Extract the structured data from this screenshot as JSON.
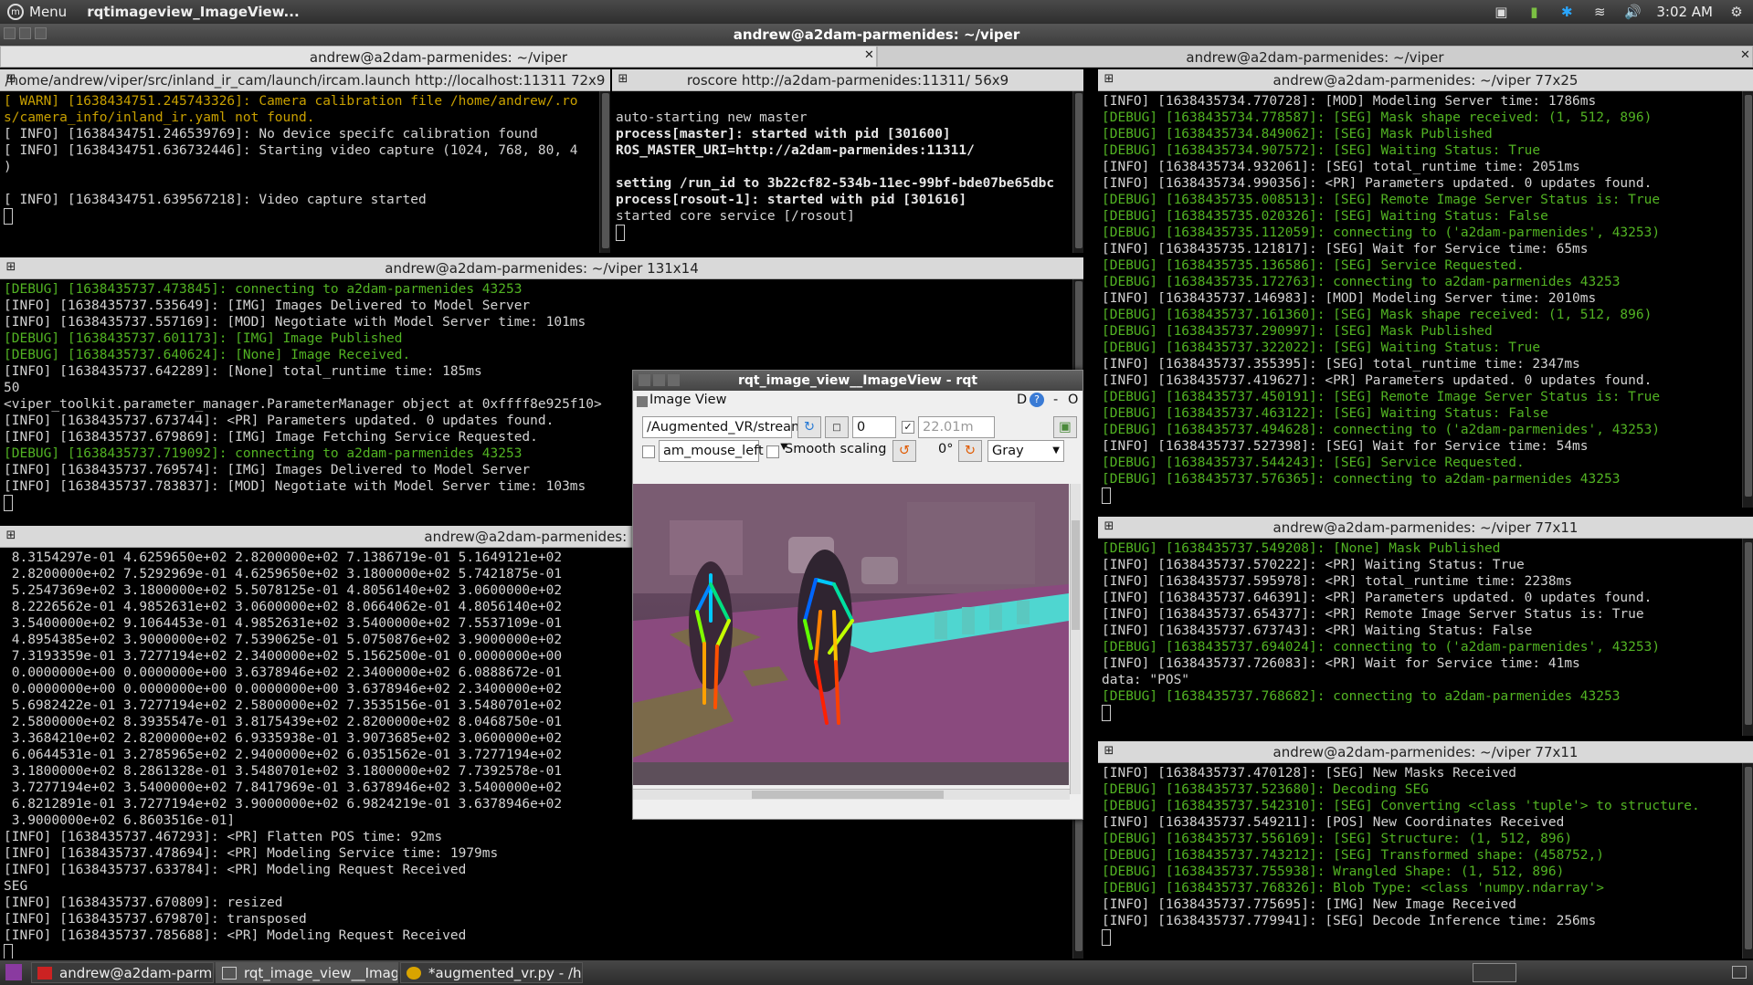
{
  "topbar": {
    "menu_label": "Menu",
    "app_title": "rqtimageview_ImageView...",
    "clock": "3:02 AM"
  },
  "window_title": "andrew@a2dam-parmenides: ~/viper",
  "tabs": [
    {
      "label": "andrew@a2dam-parmenides: ~/viper"
    },
    {
      "label": "andrew@a2dam-parmenides: ~/viper"
    }
  ],
  "panes": {
    "launch": {
      "title": "/home/andrew/viper/src/inland_ir_cam/launch/ircam.launch http://localhost:11311 72x9",
      "lines": [
        {
          "t": "[ WARN] [1638434751.245743326]: Camera calibration file /home/andrew/.ro",
          "c": "y"
        },
        {
          "t": "s/camera_info/inland_ir.yaml not found.",
          "c": "y"
        },
        {
          "t": "[ INFO] [1638434751.246539769]: No device specifc calibration found",
          "c": "w"
        },
        {
          "t": "[ INFO] [1638434751.636732446]: Starting video capture (1024, 768, 80, 4",
          "c": "w"
        },
        {
          "t": ")",
          "c": "w"
        },
        {
          "t": "",
          "c": "w"
        },
        {
          "t": "[ INFO] [1638434751.639567218]: Video capture started",
          "c": "w"
        }
      ]
    },
    "roscore": {
      "title": "roscore http://a2dam-parmenides:11311/ 56x9",
      "lines": [
        {
          "t": "",
          "c": "w"
        },
        {
          "t": "auto-starting new master",
          "c": "w"
        },
        {
          "t": "process[master]: started with pid [301600]",
          "c": "b"
        },
        {
          "t": "ROS_MASTER_URI=http://a2dam-parmenides:11311/",
          "c": "b"
        },
        {
          "t": "",
          "c": "w"
        },
        {
          "t": "setting /run_id to 3b22cf82-534b-11ec-99bf-bde07be65dbc",
          "c": "b"
        },
        {
          "t": "process[rosout-1]: started with pid [301616]",
          "c": "b"
        },
        {
          "t": "started core service [/rosout]",
          "c": "w"
        }
      ]
    },
    "mid": {
      "title": "andrew@a2dam-parmenides: ~/viper 131x14",
      "lines": [
        {
          "t": "[DEBUG] [1638435737.473845]: connecting to a2dam-parmenides 43253",
          "c": "g"
        },
        {
          "t": "[INFO] [1638435737.535649]: [IMG] Images Delivered to Model Server",
          "c": "w"
        },
        {
          "t": "[INFO] [1638435737.557169]: [MOD] Negotiate with Model Server time: 101ms",
          "c": "w"
        },
        {
          "t": "[DEBUG] [1638435737.601173]: [IMG] Image Published",
          "c": "g"
        },
        {
          "t": "[DEBUG] [1638435737.640624]: [None] Image Received.",
          "c": "g"
        },
        {
          "t": "[INFO] [1638435737.642289]: [None] total_runtime time: 185ms",
          "c": "w"
        },
        {
          "t": "50",
          "c": "w"
        },
        {
          "t": "<viper_toolkit.parameter_manager.ParameterManager object at 0xffff8e925f10>",
          "c": "w"
        },
        {
          "t": "[INFO] [1638435737.673744]: <PR] Parameters updated. 0 updates found.",
          "c": "w"
        },
        {
          "t": "[INFO] [1638435737.679869]: [IMG] Image Fetching Service Requested.",
          "c": "w"
        },
        {
          "t": "[DEBUG] [1638435737.719092]: connecting to a2dam-parmenides 43253",
          "c": "g"
        },
        {
          "t": "[INFO] [1638435737.769574]: [IMG] Images Delivered to Model Server",
          "c": "w"
        },
        {
          "t": "[INFO] [1638435737.783837]: [MOD] Negotiate with Model Server time: 103ms",
          "c": "w"
        }
      ]
    },
    "bottom": {
      "title": "andrew@a2dam-parmenides: ~/vi",
      "lines": [
        {
          "t": " 8.3154297e-01 4.6259650e+02 2.8200000e+02 7.1386719e-01 5.1649121e+02",
          "c": "w"
        },
        {
          "t": " 2.8200000e+02 7.5292969e-01 4.6259650e+02 3.1800000e+02 5.7421875e-01",
          "c": "w"
        },
        {
          "t": " 5.2547369e+02 3.1800000e+02 5.5078125e-01 4.8056140e+02 3.0600000e+02",
          "c": "w"
        },
        {
          "t": " 8.2226562e-01 4.9852631e+02 3.0600000e+02 8.0664062e-01 4.8056140e+02",
          "c": "w"
        },
        {
          "t": " 3.5400000e+02 9.1064453e-01 4.9852631e+02 3.5400000e+02 7.5537109e-01",
          "c": "w"
        },
        {
          "t": " 4.8954385e+02 3.9000000e+02 7.5390625e-01 5.0750876e+02 3.9000000e+02",
          "c": "w"
        },
        {
          "t": " 7.3193359e-01 3.7277194e+02 2.3400000e+02 5.1562500e-01 0.0000000e+00",
          "c": "w"
        },
        {
          "t": " 0.0000000e+00 0.0000000e+00 3.6378946e+02 2.3400000e+02 6.0888672e-01",
          "c": "w"
        },
        {
          "t": " 0.0000000e+00 0.0000000e+00 0.0000000e+00 3.6378946e+02 2.3400000e+02",
          "c": "w"
        },
        {
          "t": " 5.6982422e-01 3.7277194e+02 2.5800000e+02 7.3535156e-01 3.5480701e+02",
          "c": "w"
        },
        {
          "t": " 2.5800000e+02 8.3935547e-01 3.8175439e+02 2.8200000e+02 8.0468750e-01",
          "c": "w"
        },
        {
          "t": " 3.3684210e+02 2.8200000e+02 6.9335938e-01 3.9073685e+02 3.0600000e+02",
          "c": "w"
        },
        {
          "t": " 6.0644531e-01 3.2785965e+02 2.9400000e+02 6.0351562e-01 3.7277194e+02",
          "c": "w"
        },
        {
          "t": " 3.1800000e+02 8.2861328e-01 3.5480701e+02 3.1800000e+02 7.7392578e-01",
          "c": "w"
        },
        {
          "t": " 3.7277194e+02 3.5400000e+02 7.8417969e-01 3.6378946e+02 3.5400000e+02",
          "c": "w"
        },
        {
          "t": " 6.8212891e-01 3.7277194e+02 3.9000000e+02 6.9824219e-01 3.6378946e+02",
          "c": "w"
        },
        {
          "t": " 3.9000000e+02 6.8603516e-01]",
          "c": "w"
        },
        {
          "t": "[INFO] [1638435737.467293]: <PR] Flatten POS time: 92ms",
          "c": "w"
        },
        {
          "t": "[INFO] [1638435737.478694]: <PR] Modeling Service time: 1979ms",
          "c": "w"
        },
        {
          "t": "[INFO] [1638435737.633784]: <PR] Modeling Request Received",
          "c": "w"
        },
        {
          "t": "SEG",
          "c": "w"
        },
        {
          "t": "[INFO] [1638435737.670809]: resized",
          "c": "w"
        },
        {
          "t": "[INFO] [1638435737.679870]: transposed",
          "c": "w"
        },
        {
          "t": "[INFO] [1638435737.785688]: <PR] Modeling Request Received",
          "c": "w"
        }
      ]
    },
    "r1": {
      "title": "andrew@a2dam-parmenides: ~/viper 77x25",
      "lines": [
        {
          "t": "[INFO] [1638435734.770728]: [MOD] Modeling Server time: 1786ms",
          "c": "w"
        },
        {
          "t": "[DEBUG] [1638435734.778587]: [SEG] Mask shape received: (1, 512, 896)",
          "c": "g"
        },
        {
          "t": "[DEBUG] [1638435734.849062]: [SEG] Mask Published",
          "c": "g"
        },
        {
          "t": "[DEBUG] [1638435734.907572]: [SEG] Waiting Status: True",
          "c": "g"
        },
        {
          "t": "[INFO] [1638435734.932061]: [SEG] total_runtime time: 2051ms",
          "c": "w"
        },
        {
          "t": "[INFO] [1638435734.990356]: <PR] Parameters updated. 0 updates found.",
          "c": "w"
        },
        {
          "t": "[DEBUG] [1638435735.008513]: [SEG] Remote Image Server Status is: True",
          "c": "g"
        },
        {
          "t": "[DEBUG] [1638435735.020326]: [SEG] Waiting Status: False",
          "c": "g"
        },
        {
          "t": "[DEBUG] [1638435735.112059]: connecting to ('a2dam-parmenides', 43253)",
          "c": "g"
        },
        {
          "t": "[INFO] [1638435735.121817]: [SEG] Wait for Service time: 65ms",
          "c": "w"
        },
        {
          "t": "[DEBUG] [1638435735.136586]: [SEG] Service Requested.",
          "c": "g"
        },
        {
          "t": "[DEBUG] [1638435735.172763]: connecting to a2dam-parmenides 43253",
          "c": "g"
        },
        {
          "t": "[INFO] [1638435737.146983]: [MOD] Modeling Server time: 2010ms",
          "c": "w"
        },
        {
          "t": "[DEBUG] [1638435737.161360]: [SEG] Mask shape received: (1, 512, 896)",
          "c": "g"
        },
        {
          "t": "[DEBUG] [1638435737.290997]: [SEG] Mask Published",
          "c": "g"
        },
        {
          "t": "[DEBUG] [1638435737.322022]: [SEG] Waiting Status: True",
          "c": "g"
        },
        {
          "t": "[INFO] [1638435737.355395]: [SEG] total_runtime time: 2347ms",
          "c": "w"
        },
        {
          "t": "[INFO] [1638435737.419627]: <PR] Parameters updated. 0 updates found.",
          "c": "w"
        },
        {
          "t": "[DEBUG] [1638435737.450191]: [SEG] Remote Image Server Status is: True",
          "c": "g"
        },
        {
          "t": "[DEBUG] [1638435737.463122]: [SEG] Waiting Status: False",
          "c": "g"
        },
        {
          "t": "[DEBUG] [1638435737.494628]: connecting to ('a2dam-parmenides', 43253)",
          "c": "g"
        },
        {
          "t": "[INFO] [1638435737.527398]: [SEG] Wait for Service time: 54ms",
          "c": "w"
        },
        {
          "t": "[DEBUG] [1638435737.544243]: [SEG] Service Requested.",
          "c": "g"
        },
        {
          "t": "[DEBUG] [1638435737.576365]: connecting to a2dam-parmenides 43253",
          "c": "g"
        }
      ]
    },
    "r2": {
      "title": "andrew@a2dam-parmenides: ~/viper 77x11",
      "lines": [
        {
          "t": "[DEBUG] [1638435737.549208]: [None] Mask Published",
          "c": "g"
        },
        {
          "t": "[INFO] [1638435737.570222]: <PR] Waiting Status: True",
          "c": "w"
        },
        {
          "t": "[INFO] [1638435737.595978]: <PR] total_runtime time: 2238ms",
          "c": "w"
        },
        {
          "t": "[INFO] [1638435737.646391]: <PR] Parameters updated. 0 updates found.",
          "c": "w"
        },
        {
          "t": "[INFO] [1638435737.654377]: <PR] Remote Image Server Status is: True",
          "c": "w"
        },
        {
          "t": "[INFO] [1638435737.673743]: <PR] Waiting Status: False",
          "c": "w"
        },
        {
          "t": "[DEBUG] [1638435737.694024]: connecting to ('a2dam-parmenides', 43253)",
          "c": "g"
        },
        {
          "t": "[INFO] [1638435737.726083]: <PR] Wait for Service time: 41ms",
          "c": "w"
        },
        {
          "t": "data: \"POS\"",
          "c": "w"
        },
        {
          "t": "[DEBUG] [1638435737.768682]: connecting to a2dam-parmenides 43253",
          "c": "g"
        }
      ]
    },
    "r3": {
      "title": "andrew@a2dam-parmenides: ~/viper 77x11",
      "lines": [
        {
          "t": "[INFO] [1638435737.470128]: [SEG] New Masks Received",
          "c": "w"
        },
        {
          "t": "[DEBUG] [1638435737.523680]: Decoding SEG",
          "c": "g"
        },
        {
          "t": "[DEBUG] [1638435737.542310]: [SEG] Converting <class 'tuple'> to structure.",
          "c": "g"
        },
        {
          "t": "[INFO] [1638435737.549211]: [POS] New Coordinates Received",
          "c": "w"
        },
        {
          "t": "[DEBUG] [1638435737.556169]: [SEG] Structure: (1, 512, 896)",
          "c": "g"
        },
        {
          "t": "[DEBUG] [1638435737.743212]: [SEG] Transformed shape: (458752,)",
          "c": "g"
        },
        {
          "t": "[DEBUG] [1638435737.755938]: Wrangled Shape: (1, 512, 896)",
          "c": "g"
        },
        {
          "t": "[DEBUG] [1638435737.768326]: Blob Type: <class 'numpy.ndarray'>",
          "c": "g"
        },
        {
          "t": "[INFO] [1638435737.775695]: [IMG] New Image Received",
          "c": "w"
        },
        {
          "t": "[INFO] [1638435737.779941]: [SEG] Decode Inference time: 256ms",
          "c": "w"
        }
      ]
    }
  },
  "rqt": {
    "title": "rqt_image_view__ImageView - rqt",
    "plugin_label": "Image View",
    "topic": "/Augmented_VR/stream",
    "spin_value": "0",
    "max_range": "22.01m",
    "mouse_topic": "am_mouse_left",
    "smooth_label": "Smooth scaling",
    "rotation": "0°",
    "color_scheme": "Gray",
    "d_label": "D",
    "dash": "-",
    "o_label": "O"
  },
  "taskbar": {
    "items": [
      {
        "label": "andrew@a2dam-parm..."
      },
      {
        "label": "rqt_image_view__Imag..."
      },
      {
        "label": "*augmented_vr.py - /ho..."
      }
    ]
  },
  "colors": {
    "debug": "#52b323",
    "warn": "#c8a000",
    "info": "#d3d3d3",
    "seg_overlay": "#8a4a7e",
    "crosswalk": "#4fd6d0"
  }
}
